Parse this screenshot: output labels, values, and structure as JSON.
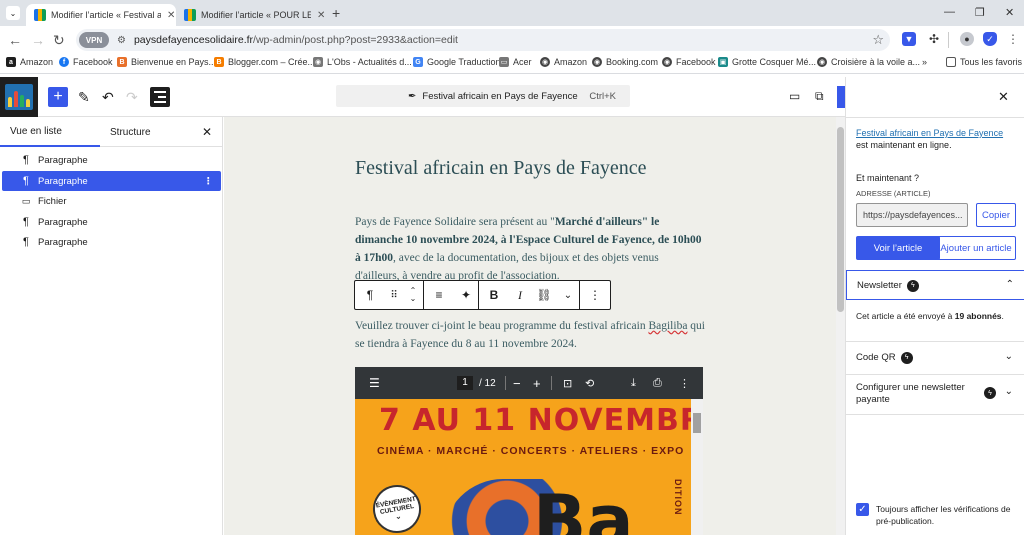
{
  "browser": {
    "tabs": [
      {
        "title": "Modifier l’article « Festival africain en Pays de Fayence »"
      },
      {
        "title": "Modifier l’article « POUR LE MOIS »"
      }
    ],
    "url_domain": "paysdefayencesolidaire.fr",
    "url_path": "/wp-admin/post.php?post=2933&action=edit",
    "vpn_label": "VPN",
    "bookmarks": [
      {
        "label": "Amazon",
        "color": "#1e1e1e",
        "glyph": "a"
      },
      {
        "label": "Facebook",
        "color": "#1877f2",
        "glyph": "f"
      },
      {
        "label": "Bienvenue en Pays...",
        "color": "#e8702a",
        "glyph": "B"
      },
      {
        "label": "Blogger.com – Crée...",
        "color": "#f57d00",
        "glyph": "B"
      },
      {
        "label": "L'Obs - Actualités d...",
        "color": "#777777",
        "glyph": "◉"
      },
      {
        "label": "Google Traduction",
        "color": "#4285f4",
        "glyph": "G"
      },
      {
        "label": "Acer",
        "color": "#777777",
        "glyph": "▭"
      },
      {
        "label": "Amazon",
        "color": "#444444",
        "glyph": "◉"
      },
      {
        "label": "Booking.com",
        "color": "#444444",
        "glyph": "◉"
      },
      {
        "label": "Facebook",
        "color": "#444444",
        "glyph": "◉"
      },
      {
        "label": "Grotte Cosquer Mé...",
        "color": "#1a8a8a",
        "glyph": "▣"
      },
      {
        "label": "Croisière à la voile a...",
        "color": "#444444",
        "glyph": "◉"
      }
    ],
    "bookmarks_more": "»",
    "all_favorites": "Tous les favoris"
  },
  "editor": {
    "command_title": "Festival africain en Pays de Fayence",
    "command_shortcut": "Ctrl+K"
  },
  "left_panel": {
    "tabs": [
      "Vue en liste",
      "Structure"
    ],
    "items": [
      {
        "icon": "¶",
        "label": "Paragraphe",
        "selected": false
      },
      {
        "icon": "¶",
        "label": "Paragraphe",
        "selected": true
      },
      {
        "icon": "folder",
        "label": "Fichier",
        "selected": false
      },
      {
        "icon": "¶",
        "label": "Paragraphe",
        "selected": false
      },
      {
        "icon": "¶",
        "label": "Paragraphe",
        "selected": false
      }
    ]
  },
  "post": {
    "title": "Festival africain en Pays de Fayence",
    "p1_a": "Pays de Fayence Solidaire sera présent  au \"",
    "p1_b": "Marché d'ailleurs\" le  dimanche 10 novembre 2024, à l'Espace Culturel de Fayence, de 10h00 à 17h00",
    "p1_c": ", avec de la documentation, des bijoux et des objets venus d'ailleurs, à vendre au profit de l'association.",
    "p2_a": "Veuillez trouver ci-joint le beau programme du festival africain ",
    "p2_b": "Bagiliba",
    "p2_c": " qui se tiendra à Fayence du 8 au 11 novembre 2024."
  },
  "pdf": {
    "page_current": "1",
    "page_total": "/ 12",
    "headline": "7 AU 11 NOVEMBRE",
    "categories": "CINÉMA · MARCHÉ · CONCERTS · ATELIERS · EXPO",
    "seal_lines": [
      "ÉVÈNEMENT",
      "CULTUREL"
    ],
    "big_letters": "Ba",
    "vertical_text": "DITION"
  },
  "right_panel": {
    "published_link": "Festival africain en Pays de Fayence",
    "published_rest": " est maintenant en ligne.",
    "next_heading": "Et maintenant ?",
    "address_label": "ADRESSE (ARTICLE)",
    "address_value": "https://paysdefayences...",
    "copy_label": "Copier",
    "view_label": "Voir l’article",
    "add_label": "Ajouter un article",
    "newsletter_title": "Newsletter",
    "newsletter_text_a": "Cet article a été envoyé à ",
    "newsletter_count": "19 abonnés",
    "newsletter_text_b": ".",
    "qr_title": "Code QR",
    "paid_title": "Configurer une newsletter payante",
    "always_show": "Toujours afficher les vérifications de pré-publication."
  },
  "colors": {
    "accent": "#3858e9",
    "post_text": "#3c5d63",
    "canvas_bg": "#efefea"
  }
}
